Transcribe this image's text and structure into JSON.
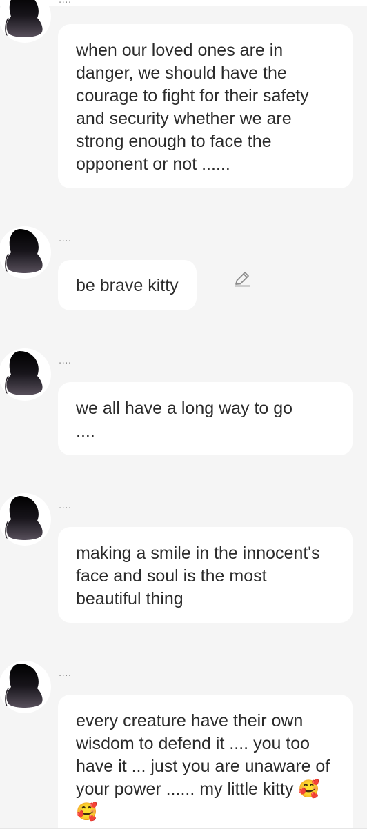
{
  "colors": {
    "background": "#f5f5f5",
    "bubble": "#ffffff",
    "text": "#2b2b2b",
    "meta": "#8e8e8e"
  },
  "messages": [
    {
      "sender_name": "....",
      "text": "when our loved ones are in danger, we should have the courage to fight for their safety and security whether we are strong enough to face the opponent or not ......"
    },
    {
      "sender_name": "....",
      "text": "be brave kitty",
      "action_icon": "edit-pencil-icon"
    },
    {
      "sender_name": "....",
      "text": "we all have a long way to go ...."
    },
    {
      "sender_name": "....",
      "text": "making a smile in the innocent's face and soul is the most beautiful thing"
    },
    {
      "sender_name": "....",
      "text": "every creature have their own wisdom to defend it .... you too have it ... just you are unaware of your power ...... my little kitty 🥰🥰"
    }
  ]
}
